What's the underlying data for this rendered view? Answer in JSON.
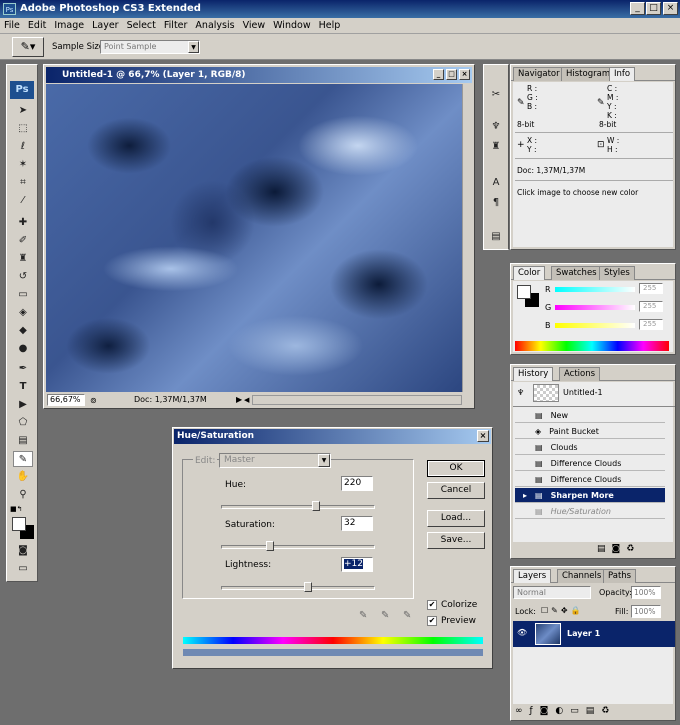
{
  "app": {
    "title": "Adobe Photoshop CS3 Extended",
    "logo": "Ps"
  },
  "menu": [
    "File",
    "Edit",
    "Image",
    "Layer",
    "Select",
    "Filter",
    "Analysis",
    "View",
    "Window",
    "Help"
  ],
  "options": {
    "sample_size_label": "Sample Size:",
    "sample_size_value": "Point Sample"
  },
  "document": {
    "title": "Untitled-1 @ 66,7% (Layer 1, RGB/8)",
    "zoom": "66,67%",
    "doc_info": "Doc: 1,37M/1,37M"
  },
  "info_panel": {
    "tabs": [
      "Navigator",
      "Histogram",
      "Info"
    ],
    "rgb": [
      "R :",
      "G :",
      "B :"
    ],
    "cmyk": [
      "C :",
      "M :",
      "Y :",
      "K :"
    ],
    "bit_left": "8-bit",
    "bit_right": "8-bit",
    "xy": [
      "X :",
      "Y :"
    ],
    "wh": [
      "W :",
      "H :"
    ],
    "doc": "Doc: 1,37M/1,37M",
    "hint": "Click image to choose new color"
  },
  "color_panel": {
    "tabs": [
      "Color",
      "Swatches",
      "Styles"
    ],
    "channels": [
      {
        "label": "R",
        "value": "255"
      },
      {
        "label": "G",
        "value": "255"
      },
      {
        "label": "B",
        "value": "255"
      }
    ]
  },
  "history_panel": {
    "tabs": [
      "History",
      "Actions"
    ],
    "snapshot": "Untitled-1",
    "items": [
      "New",
      "Paint Bucket",
      "Clouds",
      "Difference Clouds",
      "Difference Clouds",
      "Sharpen More",
      "Hue/Saturation"
    ],
    "selected_index": 5
  },
  "layers_panel": {
    "tabs": [
      "Layers",
      "Channels",
      "Paths"
    ],
    "blend_mode": "Normal",
    "opacity_label": "Opacity:",
    "opacity": "100%",
    "lock_label": "Lock:",
    "fill_label": "Fill:",
    "fill": "100%",
    "layer_name": "Layer 1"
  },
  "dialog": {
    "title": "Hue/Saturation",
    "edit_label": "Edit:",
    "edit_value": "Master",
    "hue_label": "Hue:",
    "hue": "220",
    "saturation_label": "Saturation:",
    "saturation": "32",
    "lightness_label": "Lightness:",
    "lightness": "+12",
    "ok": "OK",
    "cancel": "Cancel",
    "load": "Load...",
    "save": "Save...",
    "colorize": "Colorize",
    "preview": "Preview"
  }
}
